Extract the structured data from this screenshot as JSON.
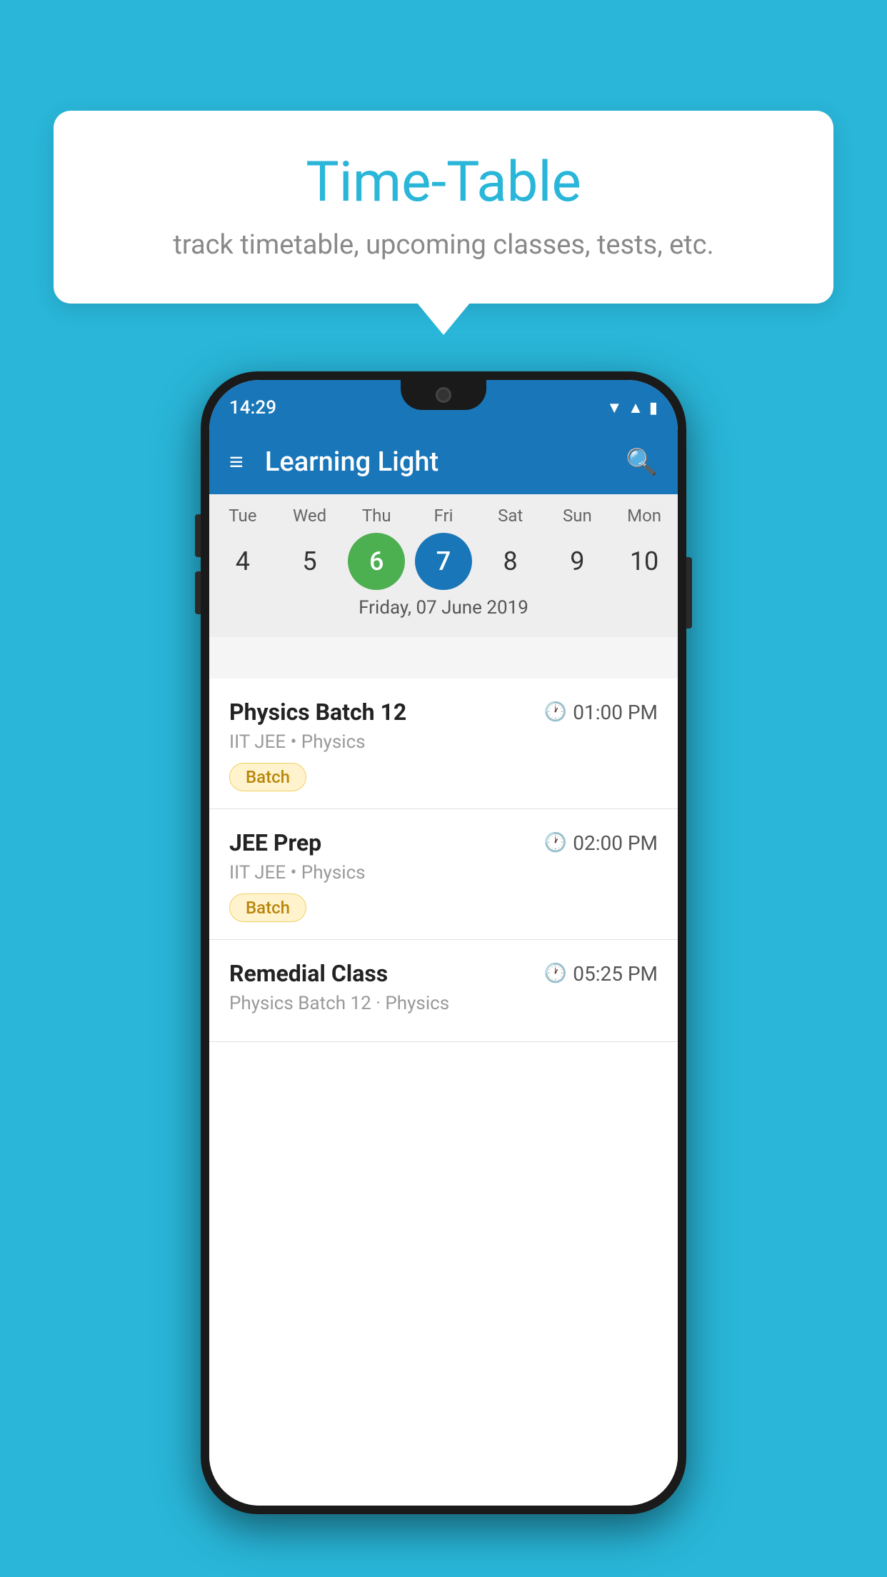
{
  "background_color": "#29B6D9",
  "speech_bubble": {
    "title": "Time-Table",
    "subtitle": "track timetable, upcoming classes, tests, etc."
  },
  "status_bar": {
    "time": "14:29"
  },
  "app_bar": {
    "title": "Learning Light"
  },
  "calendar": {
    "days_of_week": [
      "Tue",
      "Wed",
      "Thu",
      "Fri",
      "Sat",
      "Sun",
      "Mon"
    ],
    "day_numbers": [
      "4",
      "5",
      "6",
      "7",
      "8",
      "9",
      "10"
    ],
    "today_index": 2,
    "selected_index": 3,
    "selected_date_label": "Friday, 07 June 2019"
  },
  "events": [
    {
      "name": "Physics Batch 12",
      "time": "01:00 PM",
      "meta": "IIT JEE • Physics",
      "badge": "Batch"
    },
    {
      "name": "JEE Prep",
      "time": "02:00 PM",
      "meta": "IIT JEE • Physics",
      "badge": "Batch"
    },
    {
      "name": "Remedial Class",
      "time": "05:25 PM",
      "meta": "Physics Batch 12 · Physics",
      "badge": null
    }
  ],
  "icons": {
    "menu": "≡",
    "search": "🔍",
    "clock": "🕐"
  }
}
